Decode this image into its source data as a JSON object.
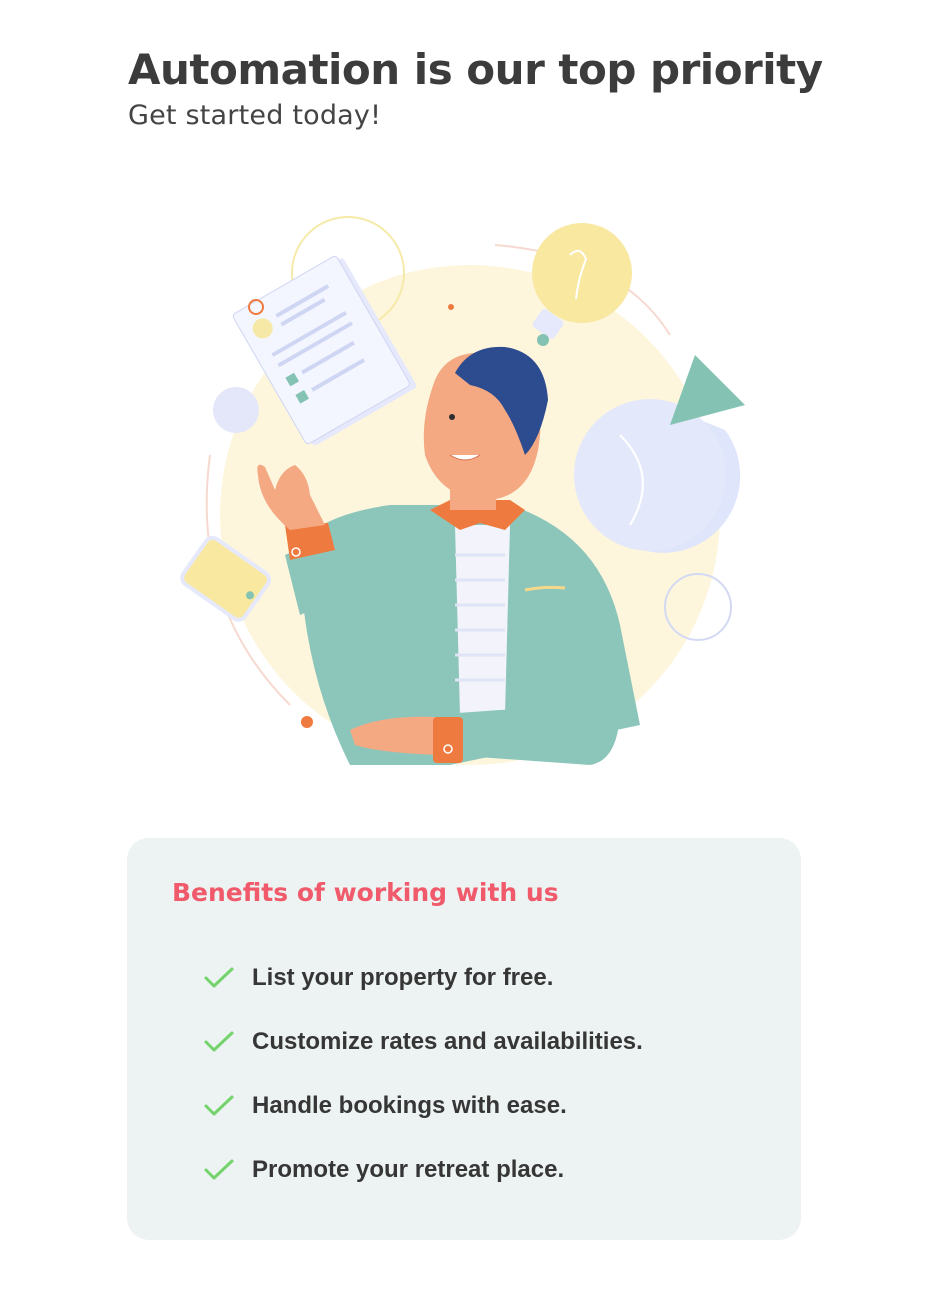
{
  "header": {
    "title": "Automation is our top priority",
    "subtitle": "Get started today!"
  },
  "illustration": {
    "icon": "person-with-ideas-illustration",
    "colors": {
      "background_circle": "#fdf6dd",
      "jacket": "#8cc6bb",
      "skin": "#f4a983",
      "hair": "#2d4b8f",
      "accent_orange": "#ee7a3f",
      "bulb": "#f8e8a0",
      "chart": "#dfe5fa",
      "chart_slice": "#84c3b3"
    }
  },
  "benefits": {
    "title": "Benefits of working with us",
    "title_color": "#f05a6a",
    "check_color": "#74d36b",
    "items": [
      {
        "label": "List your property for free."
      },
      {
        "label": "Customize rates and availabilities."
      },
      {
        "label": "Handle bookings with ease."
      },
      {
        "label": "Promote your retreat place."
      }
    ]
  }
}
